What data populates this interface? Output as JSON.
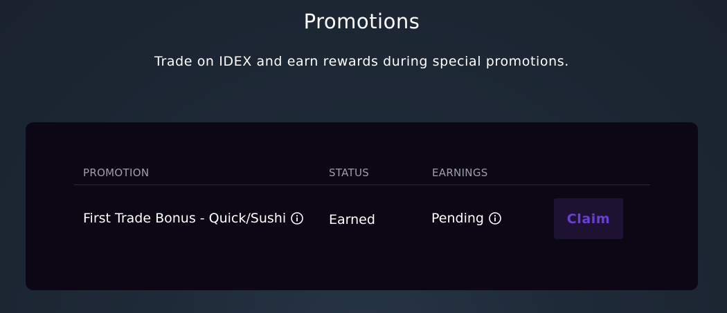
{
  "header": {
    "title": "Promotions",
    "subtitle": "Trade on IDEX and earn rewards during special promotions."
  },
  "table": {
    "columns": [
      "PROMOTION",
      "STATUS",
      "EARNINGS"
    ],
    "rows": [
      {
        "promotion": "First Trade Bonus - Quick/Sushi",
        "status": "Earned",
        "earnings": "Pending",
        "action_label": "Claim"
      }
    ]
  },
  "colors": {
    "background": "#1f2a38",
    "card": "#0b0714",
    "claim_button_bg": "#1e1233",
    "claim_button_text": "#6b3fd4",
    "header_text": "#a09ea6"
  },
  "icons": {
    "info": "info-circle-icon"
  }
}
